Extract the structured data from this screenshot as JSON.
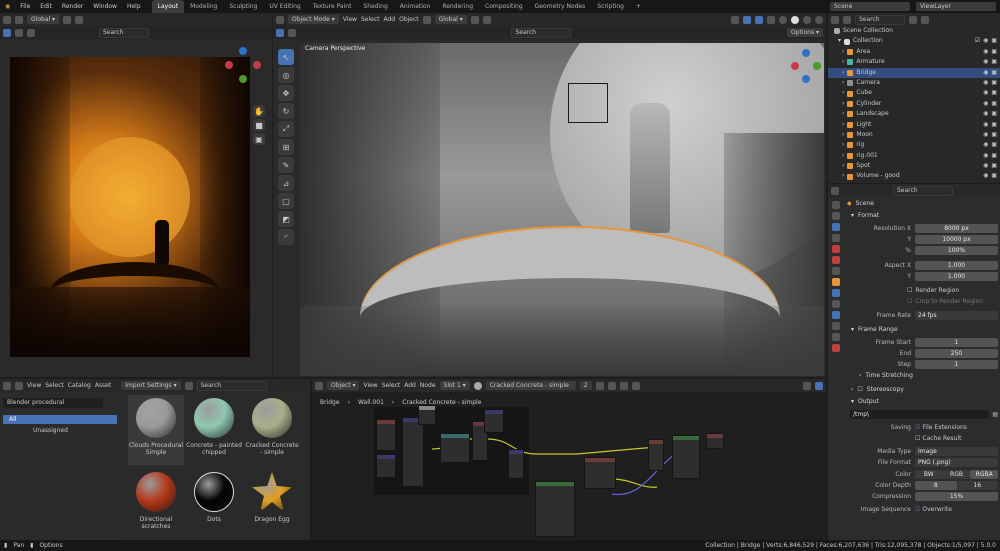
{
  "topbar": {
    "menus": [
      "File",
      "Edit",
      "Render",
      "Window",
      "Help"
    ],
    "workspaces": [
      "Layout",
      "Modeling",
      "Sculpting",
      "UV Editing",
      "Texture Paint",
      "Shading",
      "Animation",
      "Rendering",
      "Compositing",
      "Geometry Nodes",
      "Scripting"
    ],
    "active_workspace": "Layout",
    "scene": "Scene",
    "view_layer": "ViewLayer"
  },
  "image_editor": {
    "transform": "Global"
  },
  "viewport": {
    "mode": "Object Mode",
    "menus": [
      "View",
      "Select",
      "Add",
      "Object"
    ],
    "transform": "Global",
    "options": "Options",
    "overlay_title": "Camera Perspective"
  },
  "outliner": {
    "search_placeholder": "Search",
    "root": "Scene Collection",
    "collection": "Collection",
    "items": [
      "Area",
      "Armature",
      "Bridge",
      "Camera",
      "Cube",
      "Cylinder",
      "Landscape",
      "Light",
      "Moon",
      "rig",
      "rig.001",
      "Spot",
      "Volume - good"
    ],
    "selected": "Bridge"
  },
  "properties": {
    "search_placeholder": "Search",
    "context": "Scene",
    "format": {
      "title": "Format",
      "res_x_label": "Resolution X",
      "res_x": "8000 px",
      "res_y_label": "Y",
      "res_y": "10000 px",
      "pct_label": "%",
      "pct": "100%",
      "aspect_x_label": "Aspect X",
      "aspect_x": "1.000",
      "aspect_y_label": "Y",
      "aspect_y": "1.000",
      "render_region": "Render Region",
      "crop": "Crop to Render Region",
      "frame_rate_label": "Frame Rate",
      "frame_rate": "24 fps"
    },
    "frame_range": {
      "title": "Frame Range",
      "start_label": "Frame Start",
      "start": "1",
      "end_label": "End",
      "end": "250",
      "step_label": "Step",
      "step": "1",
      "time_stretching": "Time Stretching"
    },
    "stereoscopy": "Stereoscopy",
    "output": {
      "title": "Output",
      "path": "/tmp\\",
      "saving_label": "Saving",
      "file_extensions": "File Extensions",
      "cache_result": "Cache Result",
      "media_type_label": "Media Type",
      "media_type": "Image",
      "file_format_label": "File Format",
      "file_format": "PNG (.png)",
      "color_label": "Color",
      "color_opts": [
        "BW",
        "RGB",
        "RGBA"
      ],
      "color_active": "RGBA",
      "depth_label": "Color Depth",
      "depth_opts": [
        "8",
        "16"
      ],
      "depth_active": "8",
      "compression_label": "Compression",
      "compression": "15%",
      "sequence_label": "Image Sequence",
      "overwrite": "Overwrite"
    }
  },
  "asset_browser": {
    "menus": [
      "View",
      "Select",
      "Catalog",
      "Asset"
    ],
    "import_settings": "Import Settings",
    "search_placeholder": "Search",
    "library": "Blender procedural",
    "catalogs": [
      "All",
      "Unassigned"
    ],
    "assets": [
      {
        "name": "Clouds Procedural Simple",
        "color": "#9a9a9a"
      },
      {
        "name": "Concrete - painted chipped",
        "color": "#8fc8b0"
      },
      {
        "name": "Cracked Concrete - simple",
        "color": "#a7b08a"
      },
      {
        "name": "Directional scratches",
        "color": "#b5381c"
      },
      {
        "name": "Dots",
        "color": "#050505"
      },
      {
        "name": "Dragon Egg",
        "color": "#e0a020"
      }
    ]
  },
  "node_editor": {
    "mode": "Object",
    "menus": [
      "View",
      "Select",
      "Add",
      "Node"
    ],
    "slot": "Slot 1",
    "material": "Cracked Concrete - simple",
    "users": "2",
    "breadcrumb": [
      "Bridge",
      "Wall.001",
      "Cracked Concrete - simple"
    ]
  },
  "statusbar": {
    "left": [
      "Pan",
      "Options"
    ],
    "right": "Collection | Bridge | Verts:6,846,529 | Faces:6,207,636 | Tris:12,095,378 | Objects:1/5,097 | 5.0.0"
  },
  "colors": {
    "accent": "#4772b3",
    "orange": "#e8963a"
  }
}
